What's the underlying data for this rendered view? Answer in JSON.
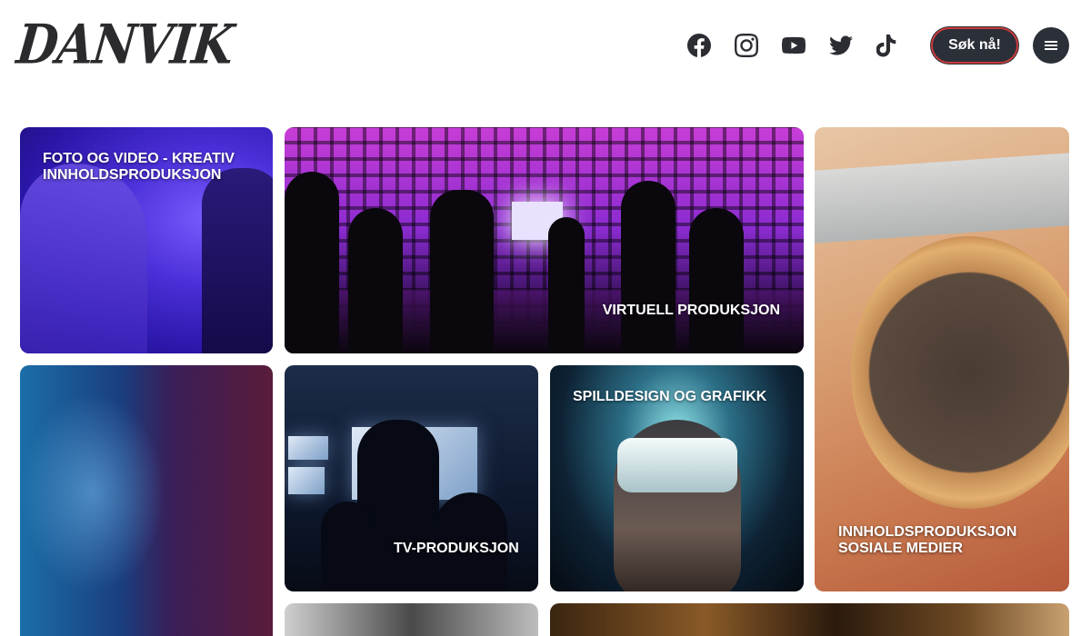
{
  "header": {
    "logo_text": "DANVIK",
    "social": [
      {
        "name": "facebook-icon"
      },
      {
        "name": "instagram-icon"
      },
      {
        "name": "youtube-icon"
      },
      {
        "name": "twitter-icon"
      },
      {
        "name": "tiktok-icon"
      }
    ],
    "cta_label": "Søk nå!",
    "menu_icon": "menu-icon"
  },
  "tiles": {
    "foto": {
      "label": "FOTO OG VIDEO - KREATIV\nINNHOLDSPRODUKSJON"
    },
    "virtuell": {
      "label": "VIRTUELL PRODUKSJON"
    },
    "sosiale": {
      "label": "INNHOLDSPRODUKSJON\nSOSIALE MEDIER"
    },
    "tv": {
      "label": "TV-PRODUKSJON"
    },
    "spilldesign": {
      "label": "SPILLDESIGN OG GRAFIKK"
    }
  },
  "colors": {
    "primary_dark": "#2b2f38",
    "accent_red": "#c93b3b",
    "text": "#1f1f22"
  }
}
